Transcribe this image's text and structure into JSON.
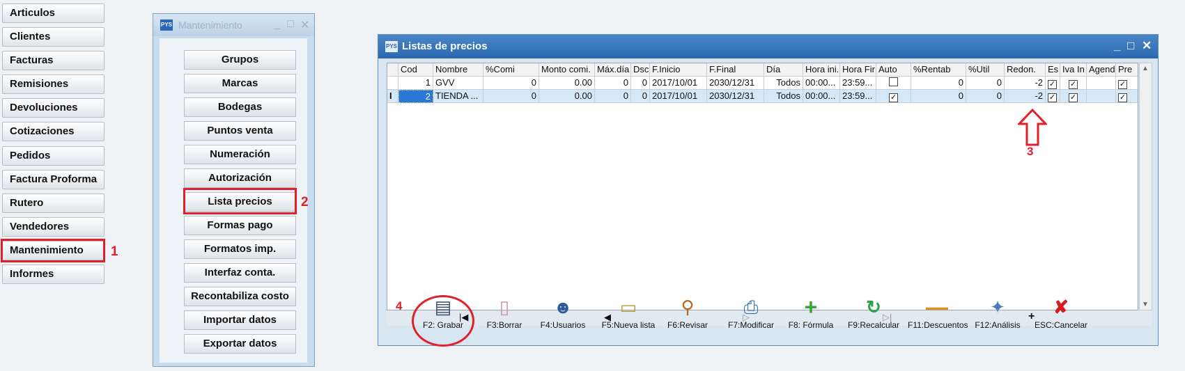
{
  "left_menu": {
    "items": [
      {
        "label": "Articulos"
      },
      {
        "label": "Clientes"
      },
      {
        "label": "Facturas"
      },
      {
        "label": "Remisiones"
      },
      {
        "label": "Devoluciones"
      },
      {
        "label": "Cotizaciones"
      },
      {
        "label": "Pedidos"
      },
      {
        "label": "Factura Proforma"
      },
      {
        "label": "Rutero"
      },
      {
        "label": "Vendedores"
      },
      {
        "label": "Mantenimiento"
      },
      {
        "label": "Informes"
      }
    ]
  },
  "annotations": {
    "n1": "1",
    "n2": "2",
    "n3": "3",
    "n4": "4"
  },
  "maint_window": {
    "title": "Mantenimiento",
    "buttons": [
      {
        "label": "Grupos"
      },
      {
        "label": "Marcas"
      },
      {
        "label": "Bodegas"
      },
      {
        "label": "Puntos venta"
      },
      {
        "label": "Numeración"
      },
      {
        "label": "Autorización"
      },
      {
        "label": "Lista precios"
      },
      {
        "label": "Formas pago"
      },
      {
        "label": "Formatos imp."
      },
      {
        "label": "Interfaz conta."
      },
      {
        "label": "Recontabiliza costo"
      },
      {
        "label": "Importar datos"
      },
      {
        "label": "Exportar datos"
      }
    ]
  },
  "listas_window": {
    "title": "Listas de precios",
    "columns": [
      "Cod",
      "Nombre",
      "%Comi",
      "Monto comi.",
      "Máx.día",
      "Dsc",
      "F.Inicio",
      "F.Final",
      "Día",
      "Hora ini.",
      "Hora Fir",
      "Auto",
      "%Rentab",
      "%Util",
      "Redon.",
      "Es",
      "Iva In",
      "Agend",
      "Pre"
    ],
    "rows": [
      {
        "cells": [
          "1",
          "GVV",
          "0",
          "0.00",
          "0",
          "0",
          "2017/10/01",
          "2030/12/31",
          "Todos",
          "00:00...",
          "23:59...",
          "",
          "0",
          "0",
          "-2",
          "",
          "",
          "",
          ""
        ],
        "checks": {
          "auto": false,
          "es": true,
          "iva": true,
          "pre": true
        }
      },
      {
        "cells": [
          "2",
          "TIENDA ...",
          "0",
          "0.00",
          "0",
          "0",
          "2017/10/01",
          "2030/12/31",
          "Todos",
          "00:00...",
          "23:59...",
          "",
          "0",
          "0",
          "-2",
          "",
          "",
          "",
          ""
        ],
        "checks": {
          "auto": true,
          "es": true,
          "iva": true,
          "pre": true
        }
      }
    ],
    "toolbar": [
      {
        "label": "F2: Grabar",
        "icon": "save-icon"
      },
      {
        "label": "F3:Borrar",
        "icon": "eraser-icon"
      },
      {
        "label": "F4:Usuarios",
        "icon": "user-search-icon"
      },
      {
        "label": "F5:Nueva lista",
        "icon": "new-document-icon"
      },
      {
        "label": "F6:Revisar",
        "icon": "magnifier-icon"
      },
      {
        "label": "F7:Modificar",
        "icon": "printer-icon"
      },
      {
        "label": "F8: Fórmula",
        "icon": "plus-icon"
      },
      {
        "label": "F9:Recalcular",
        "icon": "refresh-icon"
      },
      {
        "label": "F11:Descuentos",
        "icon": "minus-icon"
      },
      {
        "label": "F12:Análisis",
        "icon": "magic-wand-icon"
      },
      {
        "label": "ESC:Cancelar",
        "icon": "cancel-icon"
      }
    ]
  },
  "colors": {
    "accent_red": "#e0202a",
    "title_blue": "#2c68ae"
  }
}
